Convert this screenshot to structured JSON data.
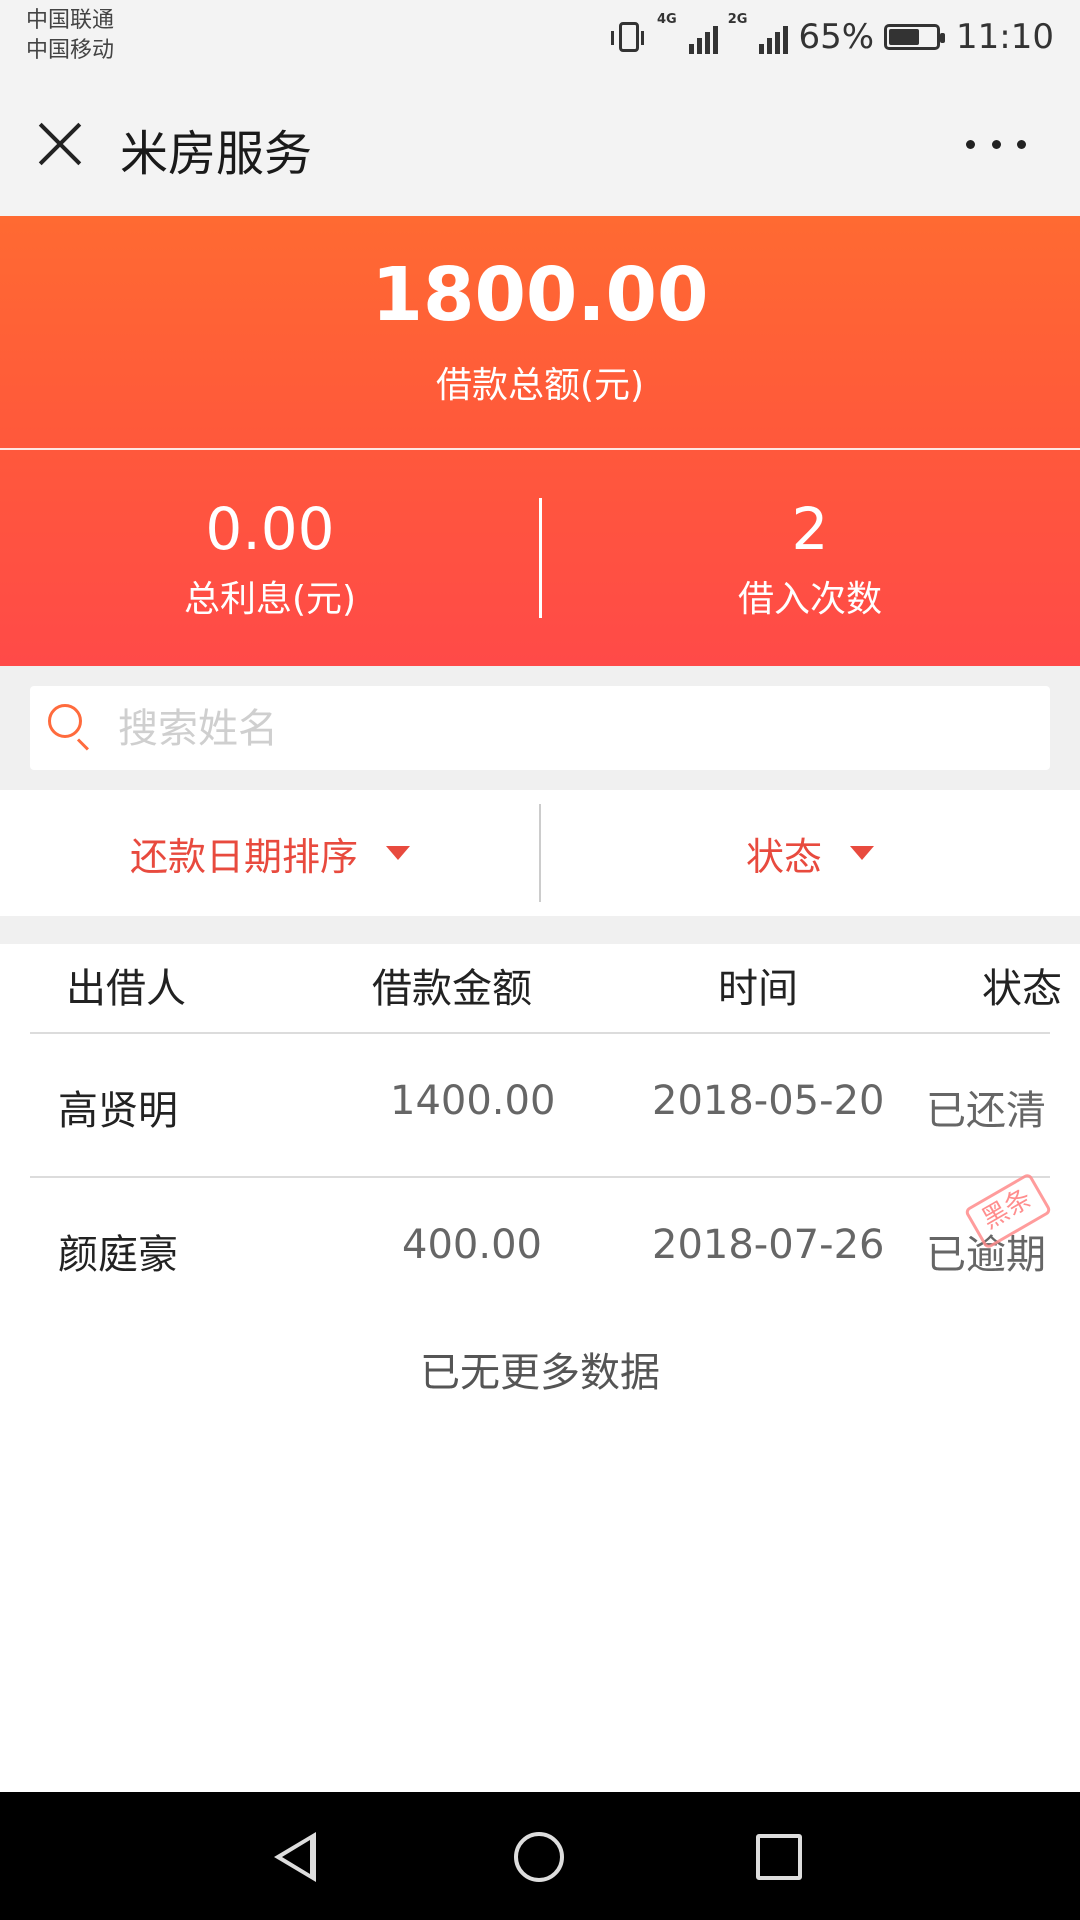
{
  "status_bar": {
    "carrier1": "中国联通",
    "carrier2": "中国移动",
    "net1": "4G",
    "net2": "2G",
    "battery": "65%",
    "battery_level": 0.65,
    "time": "11:10"
  },
  "header": {
    "title": "米房服务"
  },
  "summary": {
    "total_amount": "1800.00",
    "total_label": "借款总额(元)",
    "interest_value": "0.00",
    "interest_label": "总利息(元)",
    "count_value": "2",
    "count_label": "借入次数"
  },
  "search": {
    "placeholder": "搜索姓名"
  },
  "filters": {
    "sort_label": "还款日期排序",
    "status_label": "状态"
  },
  "table": {
    "headers": [
      "出借人",
      "借款金额",
      "时间",
      "状态"
    ],
    "rows": [
      {
        "lender": "高贤明",
        "amount": "1400.00",
        "date": "2018-05-20",
        "status": "已还清",
        "stamp": ""
      },
      {
        "lender": "颜庭豪",
        "amount": "400.00",
        "date": "2018-07-26",
        "status": "已逾期",
        "stamp": "黑条"
      }
    ]
  },
  "footer_text": "已无更多数据",
  "colors": {
    "accent": "#e84a3e",
    "header_gradient_top": "#ff6a32",
    "header_gradient_bottom": "#ff4a48"
  },
  "icons": {
    "close": "close-icon",
    "more": "more-icon",
    "search": "search-icon",
    "back": "nav-back-icon",
    "home": "nav-home-icon",
    "recent": "nav-recent-icon"
  }
}
